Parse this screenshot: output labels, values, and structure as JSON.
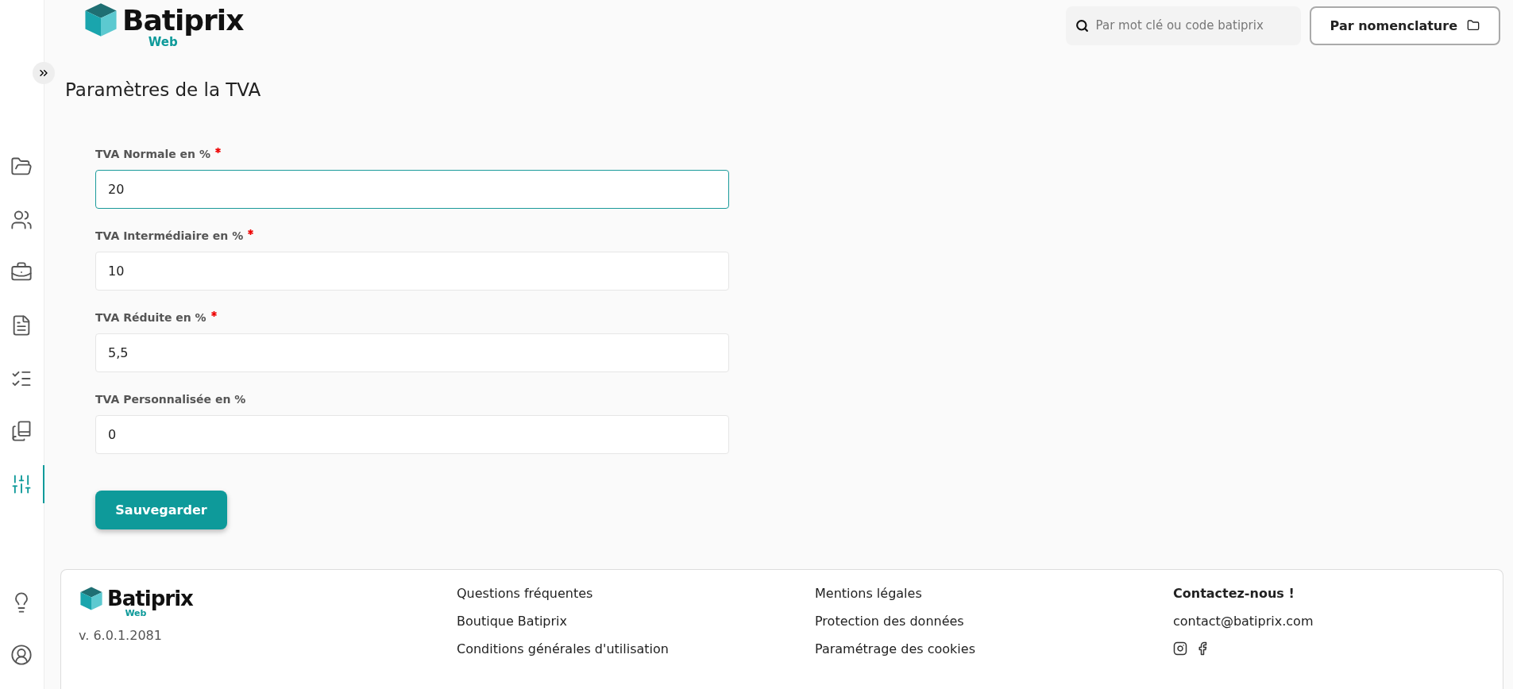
{
  "logo": {
    "name": "Batiprix",
    "sub": "Web"
  },
  "search": {
    "placeholder": "Par mot clé ou code batiprix"
  },
  "nomenclature_button": {
    "label": "Par nomenclature"
  },
  "sidebar": {
    "items": [
      {
        "kind": "folder",
        "selected": false
      },
      {
        "kind": "users",
        "selected": false
      },
      {
        "kind": "briefcase",
        "selected": false
      },
      {
        "kind": "document",
        "selected": false
      },
      {
        "kind": "checklist",
        "selected": false
      },
      {
        "kind": "bookmarks",
        "selected": false
      },
      {
        "kind": "sliders",
        "selected": true
      }
    ],
    "bottom_items": [
      {
        "kind": "lightbulb"
      },
      {
        "kind": "user"
      }
    ]
  },
  "page_title": "Paramètres de la TVA",
  "fields": [
    {
      "label": "TVA Normale en %",
      "required": true,
      "value": "20",
      "focused": true
    },
    {
      "label": "TVA Intermédiaire en %",
      "required": true,
      "value": "10",
      "focused": false
    },
    {
      "label": "TVA Réduite en %",
      "required": true,
      "value": "5,5",
      "focused": false
    },
    {
      "label": "TVA Personnalisée en %",
      "required": false,
      "value": "0",
      "focused": false
    }
  ],
  "save_button": "Sauvegarder",
  "footer": {
    "logo": {
      "name": "Batiprix",
      "sub": "Web"
    },
    "version": "v. 6.0.1.2081",
    "columns": [
      {
        "links": [
          "Questions fréquentes",
          "Boutique Batiprix",
          "Conditions générales d'utilisation"
        ]
      },
      {
        "links": [
          "Mentions légales",
          "Protection des données",
          "Paramétrage des cookies"
        ]
      }
    ],
    "contact": {
      "title": "Contactez-nous !",
      "email": "contact@batiprix.com"
    }
  }
}
